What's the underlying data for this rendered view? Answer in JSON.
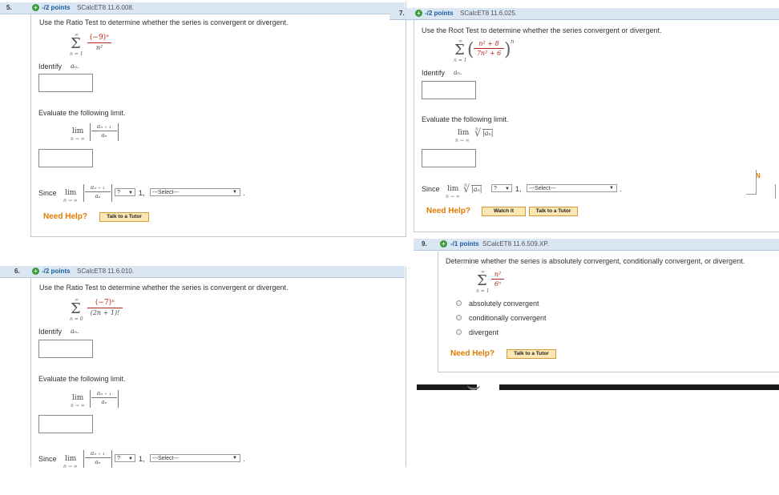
{
  "q5": {
    "num": "5.",
    "points": "-/2 points",
    "source": "SCalcET8 11.6.008.",
    "instruction": "Use the Ratio Test to determine whether the series is convergent or divergent.",
    "sum_upper": "∞",
    "sum_lower": "n = 1",
    "term_num": "(−9)ⁿ",
    "term_den": "n²",
    "identify": "Identify",
    "identify_var": "aₙ.",
    "evaluate": "Evaluate the following limit.",
    "lim": "lim",
    "lim_sub": "n → ∞",
    "ratio_num": "aₙ ₊ ₁",
    "ratio_den": "aₙ",
    "since": "Since",
    "mini_select": "?",
    "one": "1,",
    "select": "---Select---",
    "need_help": "Need Help?",
    "tutor": "Talk to a Tutor"
  },
  "q6": {
    "num": "6.",
    "points": "-/2 points",
    "source": "SCalcET8 11.6.010.",
    "instruction": "Use the Ratio Test to determine whether the series is convergent or divergent.",
    "sum_upper": "∞",
    "sum_lower": "n = 0",
    "term_num": "(−7)ⁿ",
    "term_den": "(2n + 1)!",
    "identify": "Identify",
    "identify_var": "aₙ.",
    "evaluate": "Evaluate the following limit.",
    "lim": "lim",
    "lim_sub": "n → ∞",
    "ratio_num": "aₙ ₊ ₁",
    "ratio_den": "aₙ",
    "since": "Since",
    "mini_select": "?",
    "one": "1,",
    "select": "---Select---"
  },
  "q7": {
    "num": "7.",
    "points": "-/2 points",
    "source": "SCalcET8 11.6.025.",
    "instruction": "Use the Root Test to determine whether the series convergent or divergent.",
    "sum_upper": "∞",
    "sum_lower": "n = 1",
    "term_num": "n² + 8",
    "term_den": "7n² + 6",
    "power": "n",
    "identify": "Identify",
    "identify_var": "aₙ.",
    "evaluate": "Evaluate the following limit.",
    "lim": "lim",
    "lim_sub": "n → ∞",
    "root_index": "n",
    "root_body": "|aₙ|",
    "since": "Since",
    "mini_select": "?",
    "one": "1,",
    "select": "---Select---",
    "need_help": "Need Help?",
    "watch": "Watch It",
    "tutor": "Talk to a Tutor"
  },
  "q9": {
    "num": "9.",
    "points": "-/1 points",
    "source": "SCalcET8 11.6.509.XP.",
    "instruction": "Determine whether the series is absolutely convergent, conditionally convergent, or divergent.",
    "sum_upper": "∞",
    "sum_lower": "n = 1",
    "term_num": "n²",
    "term_den": "6ⁿ",
    "options": [
      "absolutely convergent",
      "conditionally convergent",
      "divergent"
    ],
    "need_help": "Need Help?",
    "tutor": "Talk to a Tutor"
  },
  "edge_glyph": "N"
}
